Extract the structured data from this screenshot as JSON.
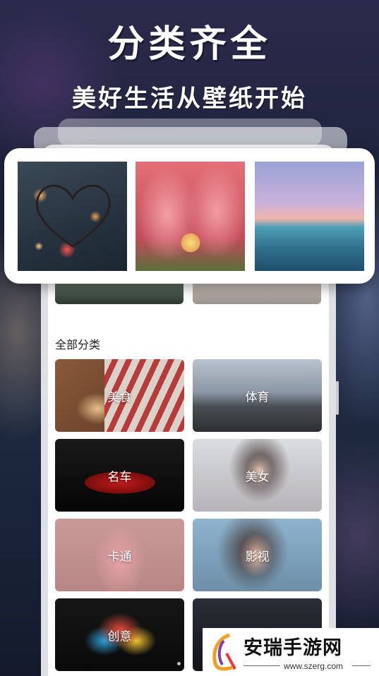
{
  "promo": {
    "headline": "分类齐全",
    "subline": "美好生活从壁纸开始"
  },
  "section": {
    "title": "全部分类"
  },
  "categories": [
    {
      "label": "美食"
    },
    {
      "label": "体育"
    },
    {
      "label": "名车"
    },
    {
      "label": "美女"
    },
    {
      "label": "卡通"
    },
    {
      "label": "影视"
    },
    {
      "label": "创意"
    },
    {
      "label": ""
    }
  ],
  "watermark": {
    "brand": "安瑞手游网",
    "url": "www.szerg.com"
  },
  "colors": {
    "card_bg": "#ffffff",
    "label_text": "#ffffff"
  }
}
